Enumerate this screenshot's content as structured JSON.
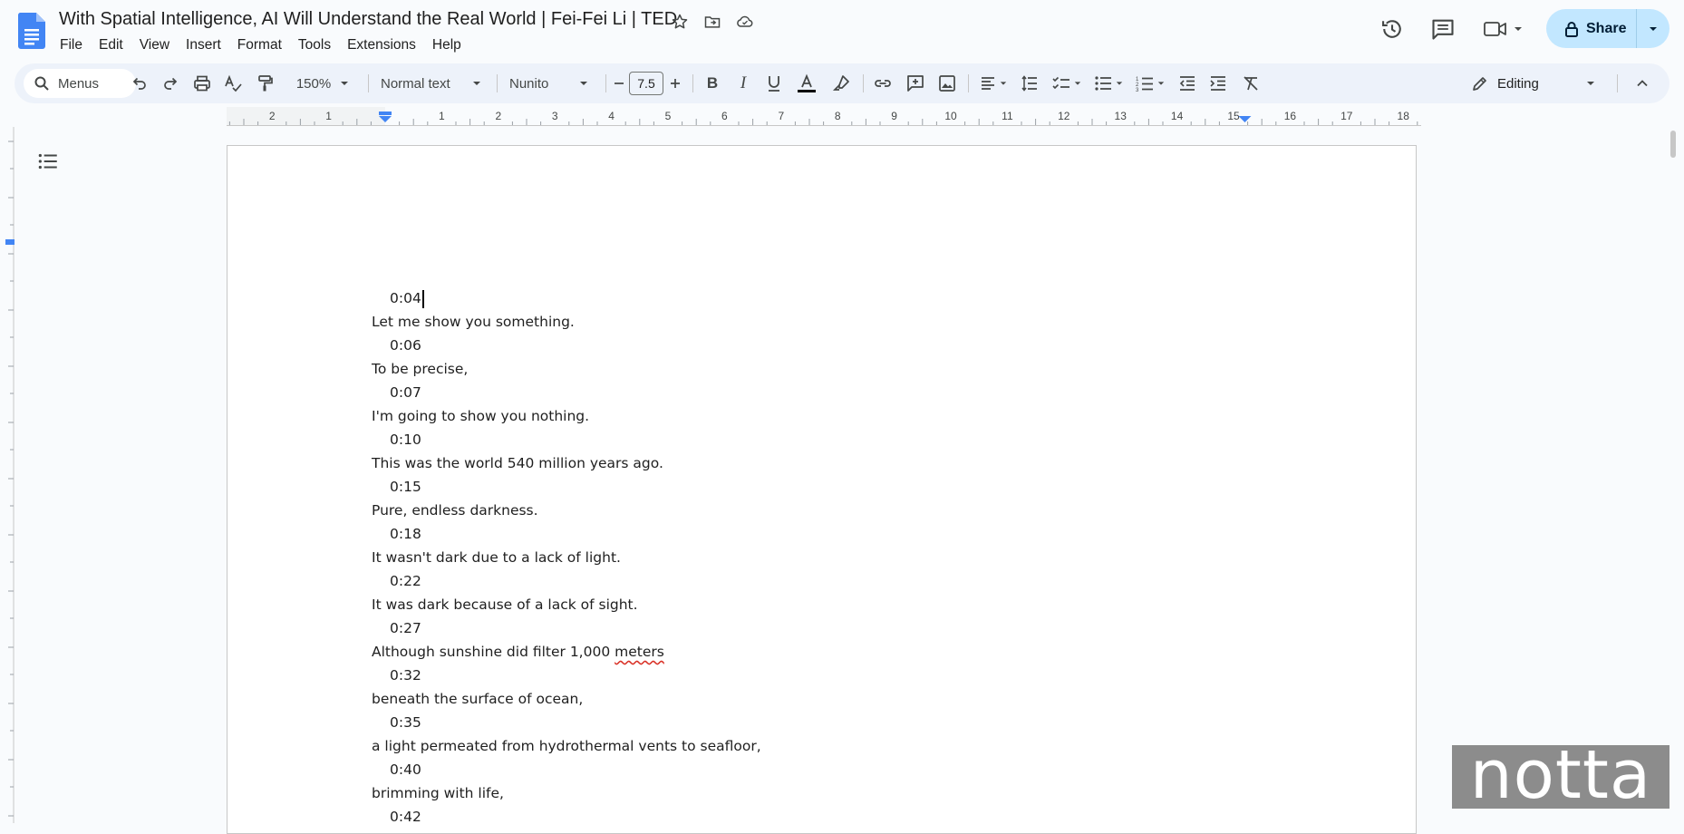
{
  "document": {
    "title": "With Spatial Intelligence, AI Will Understand the Real World | Fei-Fei Li | TED"
  },
  "menu": [
    "File",
    "Edit",
    "View",
    "Insert",
    "Format",
    "Tools",
    "Extensions",
    "Help"
  ],
  "header": {
    "share_label": "Share"
  },
  "toolbar": {
    "search_label": "Menus",
    "zoom": "150%",
    "style": "Normal text",
    "font": "Nunito",
    "font_size": "7.5",
    "mode": "Editing"
  },
  "ruler": {
    "labels": [
      "2",
      "1",
      "1",
      "2",
      "3",
      "4",
      "5",
      "6",
      "7",
      "8",
      "9",
      "10",
      "11",
      "12",
      "13",
      "14",
      "15",
      "16",
      "17",
      "18"
    ]
  },
  "transcript": [
    {
      "time": "0:04",
      "text": "Let me show you something."
    },
    {
      "time": "0:06",
      "text": "To be precise,"
    },
    {
      "time": "0:07",
      "text": "I'm going to show you nothing."
    },
    {
      "time": "0:10",
      "text": "This was the world 540 million years ago."
    },
    {
      "time": "0:15",
      "text": "Pure, endless darkness."
    },
    {
      "time": "0:18",
      "text": "It wasn't dark due to a lack of light."
    },
    {
      "time": "0:22",
      "text": "It was dark because of a lack of sight."
    },
    {
      "time": "0:27",
      "text": "Although sunshine did filter 1,000 meters"
    },
    {
      "time": "0:32",
      "text": "beneath the surface of ocean,"
    },
    {
      "time": "0:35",
      "text": "a light permeated from hydrothermal vents to seafloor,"
    },
    {
      "time": "0:40",
      "text": "brimming with life,"
    },
    {
      "time": "0:42",
      "text": ""
    }
  ],
  "spell_word": "meters",
  "watermark": "notta",
  "colors": {
    "accent": "#0b57d0",
    "share_bg": "#c2e7ff",
    "toolbar_bg": "#edf2fa",
    "spell_error": "#d93025"
  }
}
